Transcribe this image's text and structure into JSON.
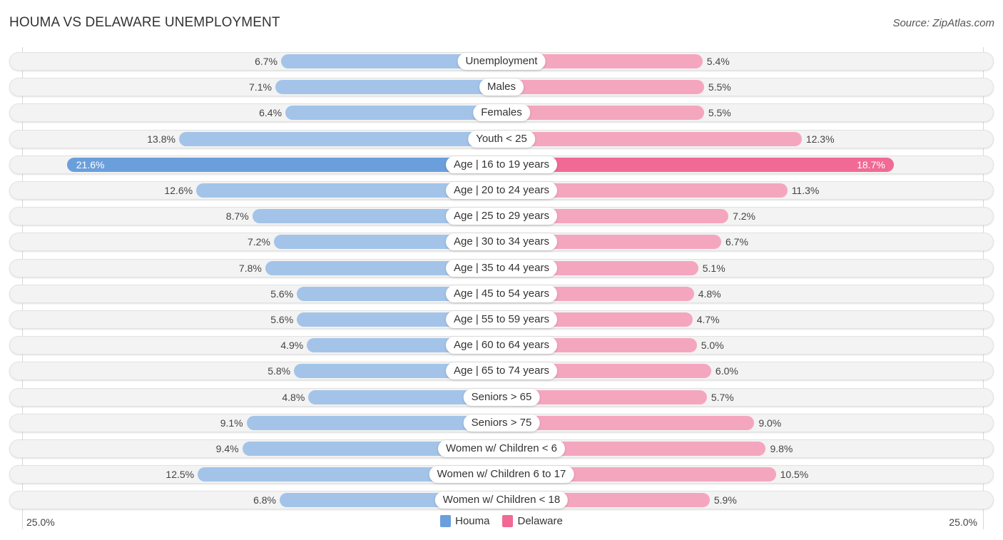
{
  "header": {
    "title": "HOUMA VS DELAWARE UNEMPLOYMENT",
    "source": "Source: ZipAtlas.com"
  },
  "colors": {
    "houma": "#a3c4e8",
    "houma_highlight": "#6a9fdc",
    "delaware": "#f5a6bf",
    "delaware_highlight": "#f06a95"
  },
  "chart_data": {
    "type": "bar",
    "orientation": "horizontal-diverging",
    "title": "HOUMA VS DELAWARE UNEMPLOYMENT",
    "categories": [
      "Unemployment",
      "Males",
      "Females",
      "Youth < 25",
      "Age | 16 to 19 years",
      "Age | 20 to 24 years",
      "Age | 25 to 29 years",
      "Age | 30 to 34 years",
      "Age | 35 to 44 years",
      "Age | 45 to 54 years",
      "Age | 55 to 59 years",
      "Age | 60 to 64 years",
      "Age | 65 to 74 years",
      "Seniors > 65",
      "Seniors > 75",
      "Women w/ Children < 6",
      "Women w/ Children 6 to 17",
      "Women w/ Children < 18"
    ],
    "series": [
      {
        "name": "Houma",
        "values": [
          6.7,
          7.1,
          6.4,
          13.8,
          21.6,
          12.6,
          8.7,
          7.2,
          7.8,
          5.6,
          5.6,
          4.9,
          5.8,
          4.8,
          9.1,
          9.4,
          12.5,
          6.8
        ],
        "labels": [
          "6.7%",
          "7.1%",
          "6.4%",
          "13.8%",
          "21.6%",
          "12.6%",
          "8.7%",
          "7.2%",
          "7.8%",
          "5.6%",
          "5.6%",
          "4.9%",
          "5.8%",
          "4.8%",
          "9.1%",
          "9.4%",
          "12.5%",
          "6.8%"
        ]
      },
      {
        "name": "Delaware",
        "values": [
          5.4,
          5.5,
          5.5,
          12.3,
          18.7,
          11.3,
          7.2,
          6.7,
          5.1,
          4.8,
          4.7,
          5.0,
          6.0,
          5.7,
          9.0,
          9.8,
          10.5,
          5.9
        ],
        "labels": [
          "5.4%",
          "5.5%",
          "5.5%",
          "12.3%",
          "18.7%",
          "11.3%",
          "7.2%",
          "6.7%",
          "5.1%",
          "4.8%",
          "4.7%",
          "5.0%",
          "6.0%",
          "5.7%",
          "9.0%",
          "9.8%",
          "10.5%",
          "5.9%"
        ]
      }
    ],
    "highlighted_index": 4,
    "xlim": [
      -25.0,
      25.0
    ],
    "axis_labels": {
      "left": "25.0%",
      "right": "25.0%"
    },
    "legend": {
      "position": "bottom-center",
      "entries": [
        "Houma",
        "Delaware"
      ]
    },
    "grid": false
  }
}
